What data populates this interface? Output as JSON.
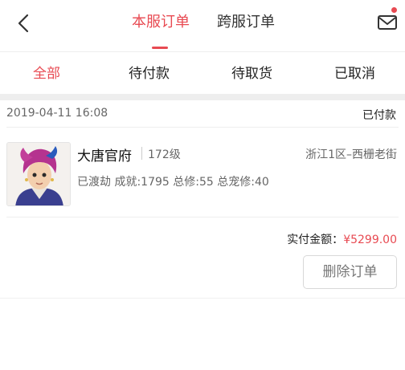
{
  "header": {
    "tabs": [
      {
        "label": "本服订单",
        "active": true
      },
      {
        "label": "跨服订单",
        "active": false
      }
    ],
    "back_icon": "chevron-left-icon",
    "mail_icon": "mail-icon",
    "accent_color": "#e84a52"
  },
  "filters": [
    {
      "label": "全部",
      "active": true
    },
    {
      "label": "待付款",
      "active": false
    },
    {
      "label": "待取货",
      "active": false
    },
    {
      "label": "已取消",
      "active": false
    }
  ],
  "order": {
    "date": "2019-04-11 16:08",
    "status": "已付款",
    "server": "大唐官府",
    "level": "172级",
    "region": "浙江1区–西栅老街",
    "stats": "已渡劫 成就:1795 总修:55 总宠修:40",
    "amount_label": "实付金额：",
    "amount_value": "¥5299.00",
    "delete_label": "删除订单"
  }
}
